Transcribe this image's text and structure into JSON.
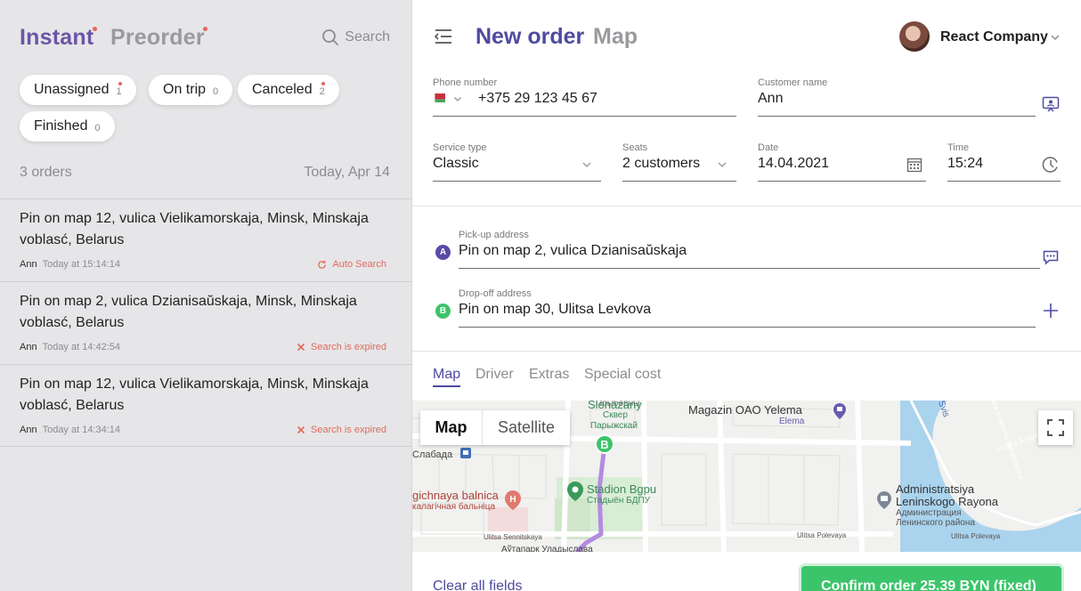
{
  "left": {
    "tabs": [
      {
        "label": "Instant",
        "active": true,
        "has_dot": true
      },
      {
        "label": "Preorder",
        "active": false,
        "has_dot": true
      }
    ],
    "search_label": "Search",
    "chips": [
      {
        "label": "Unassigned",
        "count": "1",
        "has_dot": true
      },
      {
        "label": "On trip",
        "count": "0",
        "has_dot": false
      },
      {
        "label": "Canceled",
        "count": "2",
        "has_dot": true
      },
      {
        "label": "Finished",
        "count": "0",
        "has_dot": false
      }
    ],
    "orders_count": "3 orders",
    "orders_date": "Today, Apr 14",
    "orders": [
      {
        "address": "Pin on map 12, vulica Vielikamorskaja, Minsk, Minskaja voblasć, Belarus",
        "customer": "Ann",
        "time": "Today at 15:14:14",
        "status": "Auto Search",
        "status_icon": "refresh-icon"
      },
      {
        "address": "Pin on map 2, vulica Dzianisaŭskaja, Minsk, Minskaja voblasć, Belarus",
        "customer": "Ann",
        "time": "Today at 14:42:54",
        "status": "Search is expired",
        "status_icon": "close-icon"
      },
      {
        "address": "Pin on map 12, vulica Vielikamorskaja, Minsk, Minskaja voblasć, Belarus",
        "customer": "Ann",
        "time": "Today at 14:34:14",
        "status": "Search is expired",
        "status_icon": "close-icon"
      }
    ]
  },
  "header": {
    "title_active": "New order",
    "title_inactive": "Map",
    "company": "React Company"
  },
  "form": {
    "phone": {
      "label": "Phone number",
      "value": "+375 29 123 45 67"
    },
    "customer": {
      "label": "Customer name",
      "value": "Ann"
    },
    "service": {
      "label": "Service type",
      "value": "Classic"
    },
    "seats": {
      "label": "Seats",
      "value": "2 customers"
    },
    "date": {
      "label": "Date",
      "value": "14.04.2021"
    },
    "time": {
      "label": "Time",
      "value": "15:24"
    },
    "pickup": {
      "label": "Pick-up address",
      "value": "Pin on map 2, vulica Dzianisaŭskaja",
      "badge": "A"
    },
    "dropoff": {
      "label": "Drop-off address",
      "value": "Pin on map 30, Ulitsa Levkova",
      "badge": "B"
    }
  },
  "subtabs": [
    {
      "label": "Map",
      "active": true
    },
    {
      "label": "Driver",
      "active": false
    },
    {
      "label": "Extras",
      "active": false
    },
    {
      "label": "Special cost",
      "active": false
    }
  ],
  "map": {
    "toggle_map": "Map",
    "toggle_satellite": "Satellite",
    "labels": {
      "pryborn": "Прыборны",
      "sienazany": "Sienazany",
      "skver": "Сквер",
      "paryzhskaya": "Парыжскай",
      "slobada": "Слабада",
      "magazin": "Magazin OAO Yelema",
      "elema": "Elema",
      "svis": "Svis",
      "vulica_krapotk": "Vulica Krapotk",
      "vulica_maksima": "Vulica Maksima Bahdanovica",
      "admin1": "Administratsiya",
      "admin2": "Leninskogo Rayona",
      "admin3": "Администрация",
      "admin4": "Ленинского района",
      "hosp1": "gichnaya balnica",
      "hosp2": "калагічная бальніца",
      "stadion1": "Stadion Bgpu",
      "stadion2": "Стадыён БДПУ",
      "senn": "Ulitsa Sennitskaya",
      "polev1": "Ulitsa Polevaya",
      "polev2": "Ulitsa Polevaya",
      "bottom": "Аўтапарк Уладыслава"
    },
    "marker": "B"
  },
  "footer": {
    "clear_label": "Clear all fields",
    "confirm_label": "Confirm order 25.39 BYN (fixed)"
  },
  "colors": {
    "accent": "#4f4aa0",
    "brand_purple": "#6b55a8",
    "alert_red": "#e8665c",
    "confirm_green": "#3cc46a",
    "route": "#b48be0"
  }
}
